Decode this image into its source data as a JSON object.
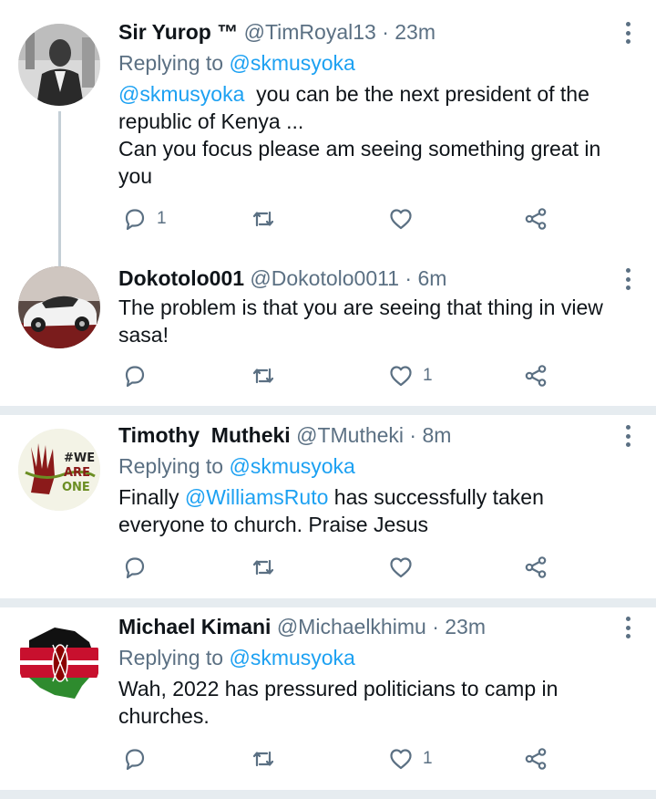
{
  "tweets": [
    {
      "name": "Sir Yurop ™",
      "handle": "@TimRoyal13",
      "time": "23m",
      "replying_prefix": "Replying to",
      "replying_to": "@skmusyoka",
      "body_mention": "@skmusyoka",
      "body_line1": "you can be the next president of the",
      "body_line2": "republic of Kenya ...",
      "body_line3": "Can you focus please am seeing something great in",
      "body_line4": "you",
      "reply_count": "1",
      "like_count": ""
    },
    {
      "name": "Dokotolo001",
      "handle": "@Dokotolo0011",
      "time": "6m",
      "body_line1": "The problem is that you are seeing that thing in view",
      "body_line2": "sasa!",
      "reply_count": "",
      "like_count": "1"
    },
    {
      "name": "Timothy  Mutheki",
      "handle": "@TMutheki",
      "time": "8m",
      "replying_prefix": "Replying to",
      "replying_to": "@skmusyoka",
      "body_pre": "Finally",
      "body_mention": "@WilliamsRuto",
      "body_post": "has successfully taken",
      "body_line2": "everyone to church. Praise Jesus",
      "reply_count": "",
      "like_count": ""
    },
    {
      "name": "Michael Kimani",
      "handle": "@Michaelkhimu",
      "time": "23m",
      "replying_prefix": "Replying to",
      "replying_to": "@skmusyoka",
      "body_line1": "Wah, 2022 has pressured politicians to camp in",
      "body_line2": "churches.",
      "reply_count": "",
      "like_count": "1"
    }
  ],
  "dot_separator": "·",
  "avatar3_text": {
    "we": "#WE",
    "are": "ARE",
    "one": "ONE"
  },
  "colors": {
    "link": "#1da1f2",
    "muted": "#5b7083",
    "separator": "#e6ecf0"
  },
  "icons": [
    "reply-icon",
    "retweet-icon",
    "like-icon",
    "share-icon",
    "more-options-icon"
  ]
}
